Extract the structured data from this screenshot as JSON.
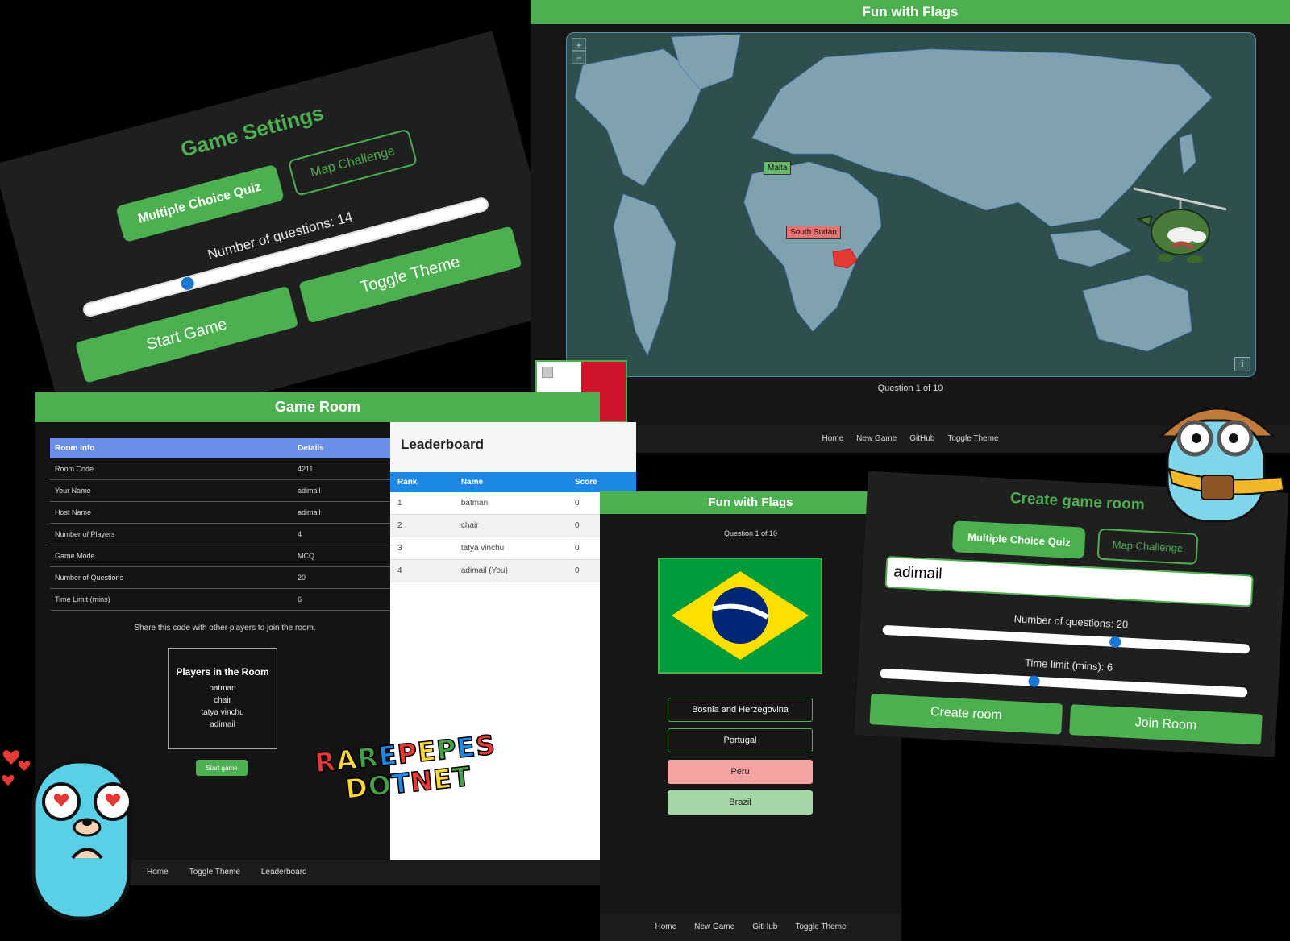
{
  "settings": {
    "title": "Game Settings",
    "mode_mcq": "Multiple Choice Quiz",
    "mode_map": "Map Challenge",
    "questions_label": "Number of questions: 14",
    "questions_value": 14,
    "start_label": "Start Game",
    "theme_label": "Toggle Theme"
  },
  "map_game": {
    "title": "Fun with Flags",
    "zoom_in": "+",
    "zoom_out": "−",
    "tag_correct": "Malta",
    "tag_wrong": "South Sudan",
    "info": "i",
    "question_count": "Question 1 of 10",
    "nav": [
      "Home",
      "New Game",
      "GitHub",
      "Toggle Theme"
    ],
    "flag_colors": [
      "#ffffff",
      "#cf142b"
    ]
  },
  "room": {
    "title": "Game Room",
    "table_headers": [
      "Room Info",
      "Details"
    ],
    "rows": [
      [
        "Room Code",
        "4211"
      ],
      [
        "Your Name",
        "adimail"
      ],
      [
        "Host Name",
        "adimail"
      ],
      [
        "Number of Players",
        "4"
      ],
      [
        "Game Mode",
        "MCQ"
      ],
      [
        "Number of Questions",
        "20"
      ],
      [
        "Time Limit (mins)",
        "6"
      ]
    ],
    "share_text": "Share this code with other players to join the room.",
    "players_title": "Players in the Room",
    "players": [
      "batman",
      "chair",
      "tatya vinchu",
      "adimail"
    ],
    "start_label": "Start game",
    "nav": [
      "Home",
      "Toggle Theme",
      "Leaderboard"
    ]
  },
  "leaderboard": {
    "title": "Leaderboard",
    "headers": [
      "Rank",
      "Name",
      "Score"
    ],
    "rows": [
      [
        "1",
        "batman",
        "0"
      ],
      [
        "2",
        "chair",
        "0"
      ],
      [
        "3",
        "tatya vinchu",
        "0"
      ],
      [
        "4",
        "adimail (You)",
        "0"
      ]
    ]
  },
  "quiz": {
    "title": "Fun with Flags",
    "question_count": "Question 1 of 10",
    "options": [
      {
        "label": "Bosnia and Herzegovina",
        "state": "neutral"
      },
      {
        "label": "Portugal",
        "state": "neutral"
      },
      {
        "label": "Peru",
        "state": "wrong"
      },
      {
        "label": "Brazil",
        "state": "right"
      }
    ],
    "nav": [
      "Home",
      "New Game",
      "GitHub",
      "Toggle Theme"
    ],
    "flag_colors": [
      "#009c3b",
      "#ffdf00",
      "#002776"
    ]
  },
  "create_room": {
    "title": "Create game room",
    "mode_mcq": "Multiple Choice Quiz",
    "mode_map": "Map Challenge",
    "name_value": "adimail",
    "questions_label": "Number of questions: 20",
    "questions_value": 20,
    "time_label": "Time limit (mins): 6",
    "time_value": 6,
    "create_label": "Create room",
    "join_label": "Join Room"
  },
  "sticker": {
    "line1": "RAREPEPES",
    "line2": "DOTNET",
    "colors": [
      "#e53935",
      "#fdd835",
      "#43a047",
      "#1e88e5"
    ]
  },
  "colors": {
    "accent": "#4caf50",
    "panel": "#1f1f1f",
    "map_land": "#7fa2ae",
    "map_sea": "#2f4f4f",
    "wrong": "#f4a3a3",
    "right": "#a5d6a7"
  }
}
